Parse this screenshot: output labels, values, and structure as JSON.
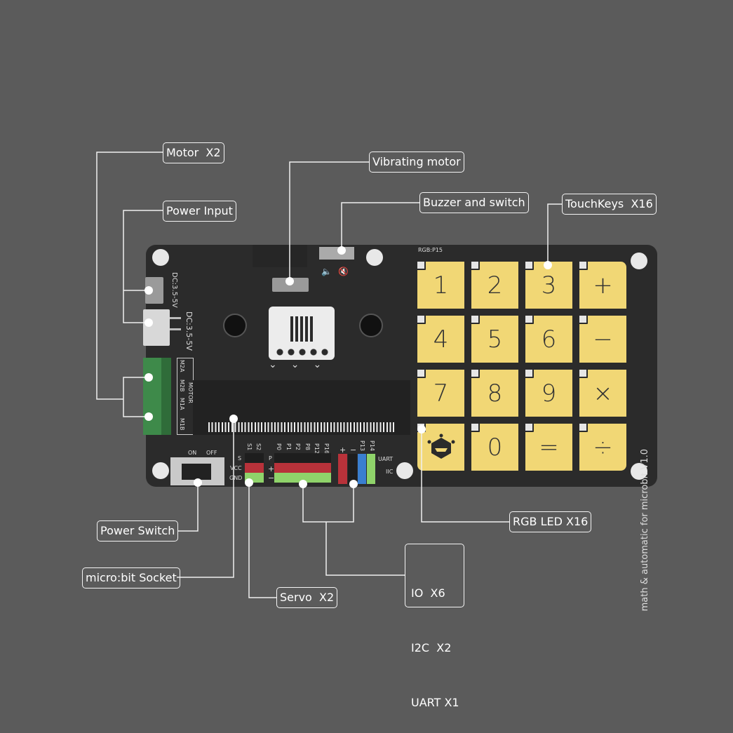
{
  "callouts": {
    "motor": "Motor  X2",
    "vibrating_motor": "Vibrating motor",
    "power_input": "Power Input",
    "buzzer": "Buzzer and switch",
    "touchkeys": "TouchKeys  X16",
    "rgb_led": "RGB LED X16",
    "power_switch": "Power Switch",
    "socket": "micro:bit Socket",
    "servo": "Servo  X2",
    "io_lines": [
      "IO  X6",
      "I2C  X2",
      "UART X1"
    ]
  },
  "board": {
    "rgb_label": "RGB:P15",
    "board_name": "math & automatic for microbit V1.0",
    "dc_label_1": "DC:3.5-5V",
    "dc_label_2": "DC:3.5-5V",
    "motor_label": "MOTOR",
    "motor_pins": [
      "M2A",
      "M2B",
      "M1A",
      "M1B"
    ],
    "switch_on": "ON",
    "switch_off": "OFF",
    "servo_rows": [
      "S",
      "VCC",
      "GND"
    ],
    "servo_pins": [
      "S1",
      "S2"
    ],
    "io_rows": [
      "P",
      "+",
      "−"
    ],
    "io_pins": [
      "P0",
      "P1",
      "P2",
      "P8",
      "P12",
      "P16"
    ],
    "i2c_pins": [
      "+",
      "−",
      "P13",
      "P14"
    ],
    "uart_label": "UART",
    "iic_label": "IIC",
    "keys": [
      "1",
      "2",
      "3",
      "+",
      "4",
      "5",
      "6",
      "−",
      "7",
      "8",
      "9",
      "×",
      "",
      "0",
      "=",
      "÷"
    ],
    "colors": {
      "key": "#f1d775",
      "board": "#2b2b2b",
      "header_red": "#b8323a",
      "header_green": "#8fd36a",
      "header_blue": "#3a7fd0",
      "terminal_green": "#3e8a4a"
    }
  }
}
